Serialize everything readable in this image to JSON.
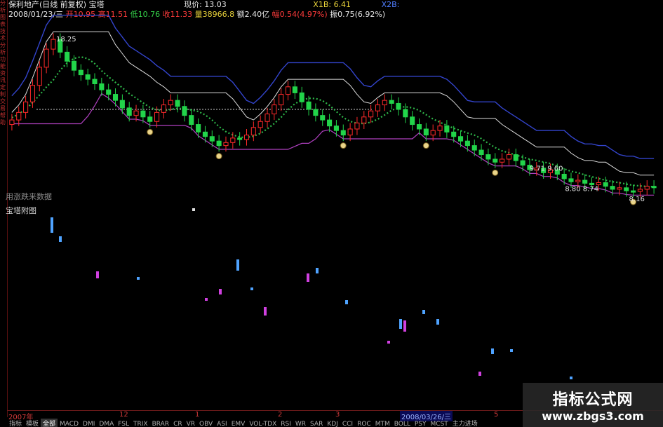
{
  "side_axis": [
    "分",
    "析",
    "图",
    "表",
    "技",
    "术",
    "分",
    "析",
    "功",
    "能",
    "资",
    "讯",
    "定",
    "制",
    "交",
    "易",
    "帮",
    "助"
  ],
  "header": {
    "line1": {
      "stock": "保利地产(日线 前复权) 宝塔",
      "price_label": "现价: 13.03",
      "x1b": "X1B: 6.41",
      "x2b": "X2B:"
    },
    "line2": {
      "date": "2008/01/23/三",
      "open": "开10.95",
      "high": "高11.51",
      "low": "低10.76",
      "close": "收11.33",
      "volume": "量38966.8",
      "amount": "额2.40亿",
      "change": "幅0.54(4.97%)",
      "amplitude": "振0.75(6.92%)"
    }
  },
  "annotations": {
    "high_label": "18.25",
    "mid_label1": "9.71 9.60",
    "mid_label2": "8.80 8.74",
    "low_label": "8.16"
  },
  "panes": {
    "main_label": "用涨跌来数据",
    "sub_label": "宝塔附图"
  },
  "xaxis": {
    "year": "2007年",
    "m12": "12",
    "m1": "1",
    "m2": "2",
    "m3": "3",
    "date_badge": "2008/03/26/三",
    "m5": "5"
  },
  "tabs": [
    "指标",
    "模板",
    "全部",
    "MACD",
    "DMI",
    "DMA",
    "FSL",
    "TRIX",
    "BRAR",
    "CR",
    "VR",
    "OBV",
    "ASI",
    "EMV",
    "VOL-TDX",
    "RSI",
    "WR",
    "SAR",
    "KDJ",
    "CCI",
    "ROC",
    "MTM",
    "BOLL",
    "PSY",
    "MCST",
    "主力进场"
  ],
  "watermark": {
    "title": "指标公式网",
    "url": "www.zbgs3.com"
  },
  "chart_data": {
    "type": "candlestick",
    "title": "保利地产(日线 前复权) 宝塔",
    "period_start": "2007年",
    "high_marker": 18.25,
    "low_marker": 8.16,
    "close": [
      12.9,
      13.4,
      14.1,
      15.2,
      16.4,
      17.6,
      18.25,
      17.4,
      16.8,
      16.2,
      15.9,
      15.6,
      15.3,
      14.9,
      14.6,
      14.2,
      13.7,
      13.2,
      13.5,
      13.1,
      12.8,
      13.4,
      13.9,
      14.2,
      13.8,
      13.2,
      12.6,
      12.1,
      11.8,
      11.5,
      11.2,
      11.4,
      11.7,
      11.6,
      11.9,
      12.4,
      12.8,
      13.3,
      13.9,
      14.6,
      15.1,
      14.7,
      14.1,
      13.6,
      13.2,
      12.9,
      12.5,
      12.2,
      11.9,
      12.3,
      12.7,
      13.1,
      13.5,
      13.9,
      14.2,
      14.0,
      13.6,
      13.1,
      12.6,
      12.3,
      11.9,
      12.2,
      12.5,
      12.1,
      11.8,
      11.5,
      11.2,
      10.9,
      10.6,
      10.3,
      10.1,
      10.3,
      10.6,
      10.2,
      9.9,
      9.6,
      9.71,
      9.4,
      9.6,
      9.3,
      9.0,
      8.8,
      8.9,
      8.7,
      8.6,
      8.74,
      8.5,
      8.3,
      8.4,
      8.2,
      8.16,
      8.3,
      8.5,
      8.4
    ]
  }
}
